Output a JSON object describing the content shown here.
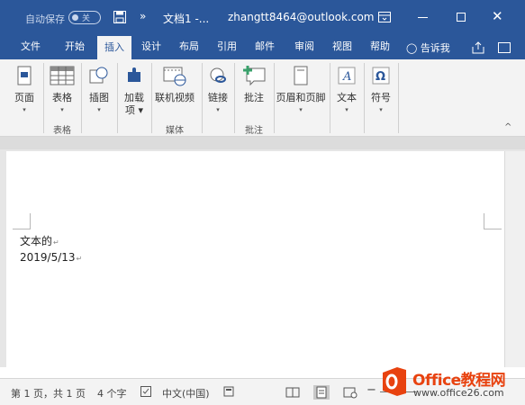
{
  "titlebar": {
    "autosave_label": "自动保存",
    "autosave_state": "关",
    "more_glyph": "»",
    "doc_name": "文档1 -...",
    "account": "zhangtt8464@outlook.com",
    "close_glyph": "✕"
  },
  "tabs": [
    {
      "label": "文件"
    },
    {
      "label": "开始"
    },
    {
      "label": "插入"
    },
    {
      "label": "设计"
    },
    {
      "label": "布局"
    },
    {
      "label": "引用"
    },
    {
      "label": "邮件"
    },
    {
      "label": "审阅"
    },
    {
      "label": "视图"
    },
    {
      "label": "帮助"
    }
  ],
  "active_tab": "插入",
  "tell_me": "告诉我",
  "ribbon": {
    "buttons": [
      {
        "label": "页面",
        "dropdown": "▾",
        "icon": "page-icon"
      },
      {
        "label": "表格",
        "dropdown": "▾",
        "icon": "table-icon"
      },
      {
        "label": "插图",
        "dropdown": "▾",
        "icon": "illustration-icon"
      },
      {
        "label": "加载",
        "label2": "项 ▾",
        "icon": "addin-icon"
      },
      {
        "label": "联机视频",
        "icon": "online-video-icon"
      },
      {
        "label": "链接",
        "dropdown": "▾",
        "icon": "link-icon"
      },
      {
        "label": "批注",
        "icon": "comment-icon"
      },
      {
        "label": "页眉和页脚",
        "dropdown": "▾",
        "icon": "header-footer-icon"
      },
      {
        "label": "文本",
        "dropdown": "▾",
        "icon": "text-icon"
      },
      {
        "label": "符号",
        "dropdown": "▾",
        "icon": "symbol-icon"
      }
    ],
    "groups": {
      "table": "表格",
      "media": "媒体",
      "comment": "批注"
    },
    "collapse_glyph": "^"
  },
  "document": {
    "lines": [
      "文本的",
      "2019/5/13"
    ],
    "pilcrow": "↵"
  },
  "statusbar": {
    "page": "第 1 页，共 1 页",
    "words": "4 个字",
    "language": "中文(中国)",
    "zoom_minus": "−"
  },
  "watermark": {
    "brand": "Office教程网",
    "url": "www.office26.com"
  },
  "colors": {
    "brand_blue": "#2b579a",
    "ribbon_bg": "#f3f3f3",
    "watermark_orange": "#e8420f"
  }
}
